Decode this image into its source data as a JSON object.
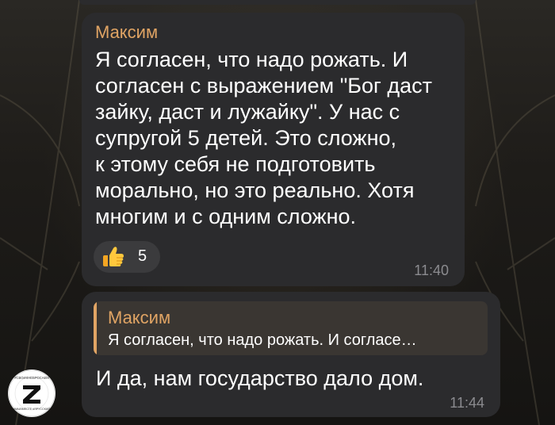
{
  "messages": [
    {
      "sender": "Максим",
      "text": "Я согласен, что надо рожать. И\nсогласен с выражением \"Бог даст\nзайку, даст и лужайку\". У нас с\nсупругой 5 детей. Это сложно,\nк этому себя не подготовить\nморально, но это реально. Хотя\nмногим и с одним сложно.",
      "reaction": {
        "icon": "thumbs-up-icon",
        "count": "5"
      },
      "time": "11:40"
    },
    {
      "reply": {
        "sender": "Максим",
        "text": "Я согласен, что надо рожать. И согласе…"
      },
      "text": "И да, нам государство дало дом.",
      "time": "11:44"
    }
  ],
  "avatar": {
    "icon": "z-emblem-icon",
    "letter": "Z",
    "top_text": "#СВОИХНЕБРОСАЕМ",
    "bottom_text": "#МЫВМЕСТЕ #ЯРУССКИЙ"
  },
  "colors": {
    "bubble": "#2b2b2d",
    "sender_name": "#e0a464",
    "timestamp": "#8b8b8f",
    "reply_bg": "#3a3632"
  }
}
